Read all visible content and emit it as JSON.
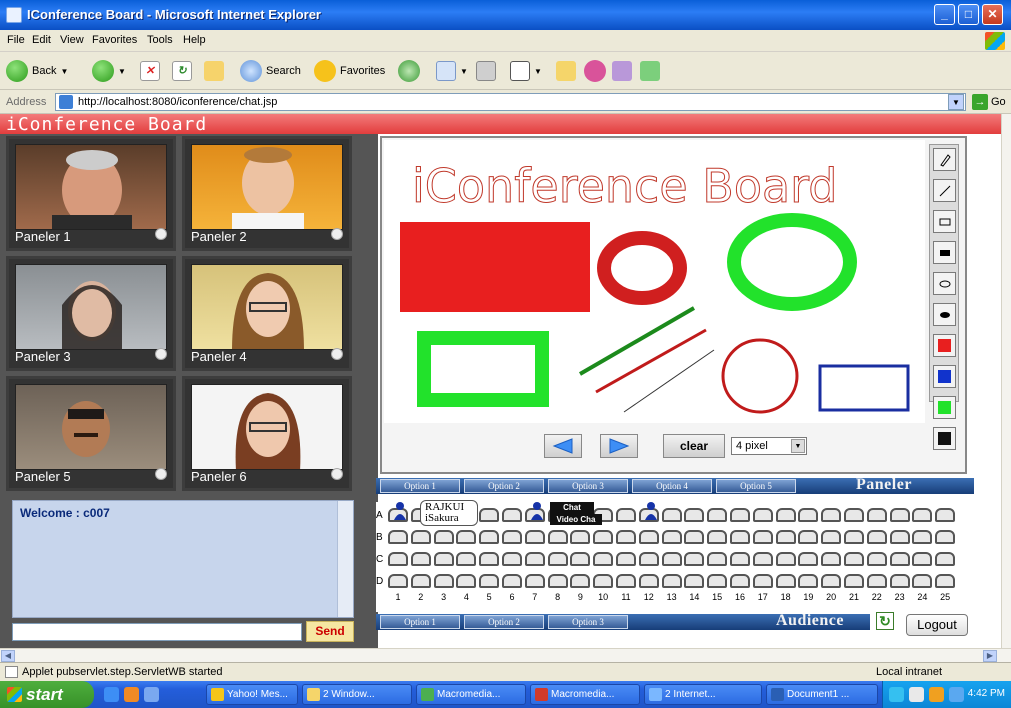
{
  "window": {
    "title": "IConference Board - Microsoft Internet Explorer"
  },
  "menu": [
    "File",
    "Edit",
    "View",
    "Favorites",
    "Tools",
    "Help"
  ],
  "toolbar": {
    "back": "Back",
    "search": "Search",
    "favorites": "Favorites"
  },
  "address": {
    "label": "Address",
    "url": "http://localhost:8080/iconference/chat.jsp",
    "go": "Go"
  },
  "page": {
    "header": "iConference Board",
    "panelists": [
      "Paneler 1",
      "Paneler 2",
      "Paneler 3",
      "Paneler 4",
      "Paneler 5",
      "Paneler 6"
    ],
    "chat": {
      "welcome": "Welcome : c007",
      "send": "Send"
    },
    "board": {
      "title": "iConference Board",
      "clear": "clear",
      "pixel": "4 pixel",
      "tools": [
        "pencil-icon",
        "line-icon",
        "rect-outline-icon",
        "rect-fill-icon",
        "oval-outline-icon",
        "oval-fill-icon"
      ],
      "colors": [
        "#e81f1f",
        "#1133cc",
        "#22e22b",
        "#111111"
      ]
    },
    "paneler_options": [
      "Option 1",
      "Option 2",
      "Option 3",
      "Option 4",
      "Option 5"
    ],
    "paneler_title": "Paneler",
    "audience_options": [
      "Option 1",
      "Option 2",
      "Option 3"
    ],
    "audience_title": "Audience",
    "seating": {
      "rows": [
        "A",
        "B",
        "C",
        "D"
      ],
      "numbers": [
        "1",
        "2",
        "3",
        "4",
        "5",
        "6",
        "7",
        "8",
        "9",
        "10",
        "11",
        "12",
        "13",
        "14",
        "15",
        "16",
        "17",
        "18",
        "19",
        "20",
        "21",
        "22",
        "23",
        "24",
        "25"
      ],
      "bubble": [
        "RAJKUI",
        "iSakura"
      ],
      "tag_chat": "Chat",
      "tag_video": "Video Cha"
    },
    "logout": "Logout"
  },
  "status": {
    "message": "Applet pubservlet.step.ServletWB started",
    "zone": "Local intranet"
  },
  "taskbar": {
    "start": "start",
    "tasks": [
      "Yahoo! Mes...",
      "2 Window...",
      "Macromedia...",
      "Macromedia...",
      "2 Internet...",
      "Document1 ..."
    ],
    "clock": "4:42 PM"
  }
}
